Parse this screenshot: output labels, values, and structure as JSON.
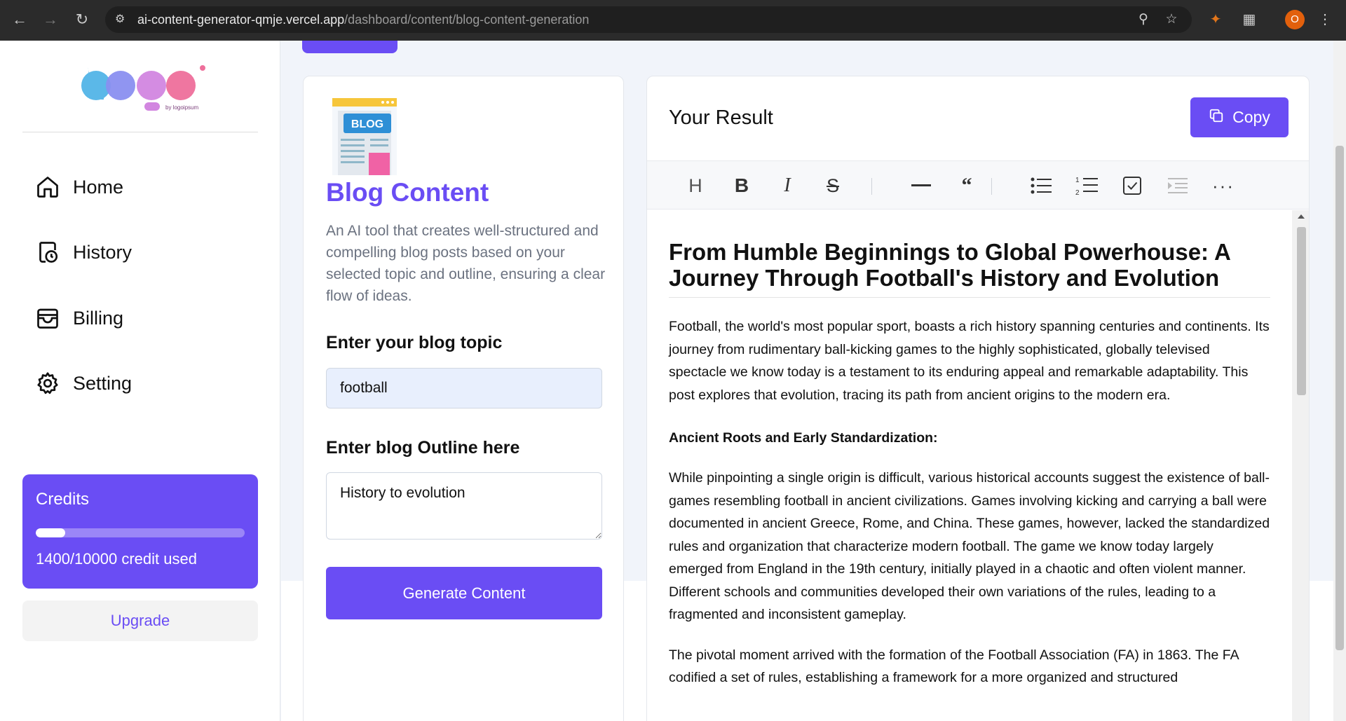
{
  "browser": {
    "url_host": "ai-content-generator-qmje.vercel.app",
    "url_path": "/dashboard/content/blog-content-generation",
    "profile_initial": "O"
  },
  "sidebar": {
    "logo_caption": "by logoipsum",
    "items": [
      {
        "label": "Home",
        "icon": "home-icon"
      },
      {
        "label": "History",
        "icon": "history-icon"
      },
      {
        "label": "Billing",
        "icon": "billing-icon"
      },
      {
        "label": "Setting",
        "icon": "gear-icon"
      }
    ],
    "credits": {
      "title": "Credits",
      "used_text": "1400/10000 credit used",
      "used_fraction": 0.14
    },
    "upgrade_label": "Upgrade"
  },
  "form": {
    "image_text": "BLOG",
    "title": "Blog Content",
    "description": "An AI tool that creates well-structured and compelling blog posts based on your selected topic and outline, ensuring a clear flow of ideas.",
    "topic_label": "Enter your blog topic",
    "topic_value": "football",
    "outline_label": "Enter blog Outline here",
    "outline_value": "History to evolution",
    "submit_label": "Generate Content"
  },
  "result": {
    "title": "Your Result",
    "copy_label": "Copy",
    "toolbar": [
      "heading-icon",
      "bold-icon",
      "italic-icon",
      "strikethrough-icon",
      "horizontal-rule-icon",
      "quote-icon",
      "bullet-list-icon",
      "ordered-list-icon",
      "task-list-icon",
      "indent-icon",
      "more-icon"
    ],
    "doc": {
      "title": "From Humble Beginnings to Global Powerhouse: A Journey Through Football's History and Evolution",
      "intro": "Football, the world's most popular sport, boasts a rich history spanning centuries and continents. Its journey from rudimentary ball-kicking games to the highly sophisticated, globally televised spectacle we know today is a testament to its enduring appeal and remarkable adaptability.  This post explores that evolution, tracing its path from ancient origins to the modern era.",
      "section1_heading": "Ancient Roots and Early Standardization:",
      "section1_p1": "While pinpointing a single origin is difficult, various historical accounts suggest the existence of ball-games resembling football in ancient civilizations.  Games involving kicking and carrying a ball were documented in ancient Greece, Rome, and China.  These games, however, lacked the standardized rules and organization that characterize modern football.  The game we know today largely emerged from England in the 19th century, initially played in a chaotic and often violent manner.  Different schools and communities developed their own variations of the rules, leading to a fragmented and inconsistent gameplay.",
      "section1_p2": "The pivotal moment arrived with the formation of the Football Association (FA) in 1863.  The FA codified a set of rules, establishing a framework for a more organized and structured"
    }
  }
}
